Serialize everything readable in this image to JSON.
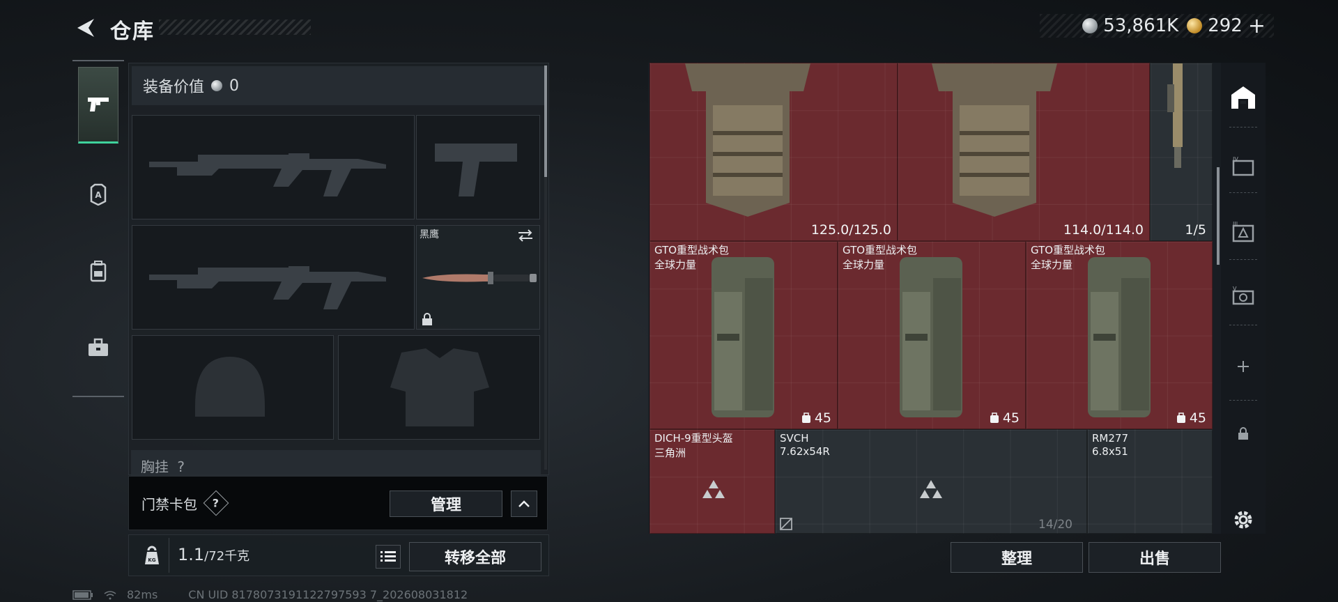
{
  "header": {
    "title": "仓库",
    "silver_amount": "53,861K",
    "gold_amount": "292",
    "plus": "+"
  },
  "left_tabs": [
    {
      "name": "weapons",
      "icon": "pistol-icon",
      "active": true
    },
    {
      "name": "armor",
      "icon": "armor-badge-icon",
      "active": false
    },
    {
      "name": "backpack",
      "icon": "backpack-icon",
      "active": false
    },
    {
      "name": "case",
      "icon": "briefcase-icon",
      "active": false
    }
  ],
  "equipment": {
    "value_label": "装备价值",
    "value": "0",
    "knife_name": "黑鹰",
    "chest_label": "胸挂",
    "chest_help": "?"
  },
  "card_bar": {
    "label": "门禁卡包",
    "help": "?",
    "manage_label": "管理"
  },
  "weight": {
    "current": "1.1",
    "max": "/72千克",
    "transfer_all_label": "转移全部",
    "kg_badge": "KG"
  },
  "status": {
    "ping": "82ms",
    "uid": "CN UID 8178073191122797593 7_202608031812"
  },
  "stash": {
    "items": [
      {
        "id": "vest-1",
        "stat": "125.0/125.0"
      },
      {
        "id": "vest-2",
        "stat": "114.0/114.0"
      },
      {
        "id": "rifle",
        "stat": "1/5"
      },
      {
        "id": "pack-1",
        "name": "GTO重型战术包",
        "sub": "全球力量",
        "stat": "45"
      },
      {
        "id": "pack-2",
        "name": "GTO重型战术包",
        "sub": "全球力量",
        "stat": "45"
      },
      {
        "id": "pack-3",
        "name": "GTO重型战术包",
        "sub": "全球力量",
        "stat": "45"
      },
      {
        "id": "helmet",
        "name": "DICH-9重型头盔",
        "sub": "三角洲"
      },
      {
        "id": "ammo-svch",
        "name": "SVCH",
        "sub": "7.62x54R"
      },
      {
        "id": "ammo-rm277",
        "name": "RM277",
        "sub": "6.8x51"
      }
    ],
    "capacity": "14/20",
    "sort_label": "整理",
    "sell_label": "出售"
  },
  "colors": {
    "accent_green": "#3fd39c",
    "item_red": "#6b2a2f",
    "panel": "#1e2328"
  }
}
